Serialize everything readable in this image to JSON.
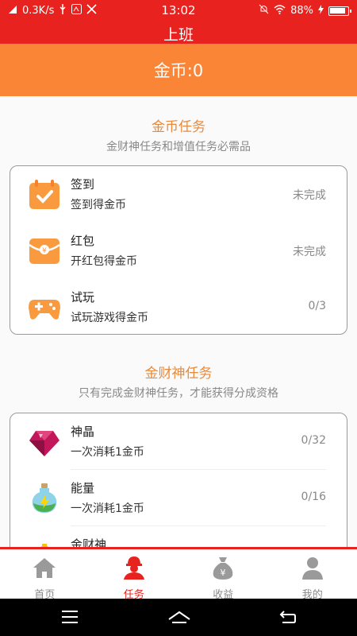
{
  "status_bar": {
    "speed": "0.3K/s",
    "time": "13:02",
    "battery": "88%"
  },
  "header": {
    "title": "上班"
  },
  "banner": {
    "coins_label": "金币:0"
  },
  "coin_tasks": {
    "title": "金币任务",
    "subtitle": "金财神任务和增值任务必需品",
    "items": [
      {
        "name": "签到",
        "desc": "签到得金币",
        "status": "未完成",
        "icon": "calendar-check-icon"
      },
      {
        "name": "红包",
        "desc": "开红包得金币",
        "status": "未完成",
        "icon": "red-envelope-icon"
      },
      {
        "name": "试玩",
        "desc": "试玩游戏得金币",
        "status": "0/3",
        "icon": "gamepad-icon"
      }
    ]
  },
  "god_tasks": {
    "title": "金财神任务",
    "subtitle": "只有完成金财神任务，才能获得分成资格",
    "items": [
      {
        "name": "神晶",
        "desc": "一次消耗1金币",
        "status": "0/32",
        "icon": "gem-icon"
      },
      {
        "name": "能量",
        "desc": "一次消耗1金币",
        "status": "0/16",
        "icon": "energy-potion-icon"
      },
      {
        "name": "金财神",
        "desc": "",
        "status": "",
        "icon": "fortune-god-icon"
      }
    ]
  },
  "bottom_nav": {
    "items": [
      {
        "label": "首页",
        "icon": "home-icon"
      },
      {
        "label": "任务",
        "icon": "task-person-icon"
      },
      {
        "label": "收益",
        "icon": "money-bag-icon"
      },
      {
        "label": "我的",
        "icon": "user-icon"
      }
    ],
    "active_index": 1
  },
  "colors": {
    "header_red": "#e8231f",
    "banner_orange": "#fb8537",
    "section_title": "#e98a3a"
  }
}
